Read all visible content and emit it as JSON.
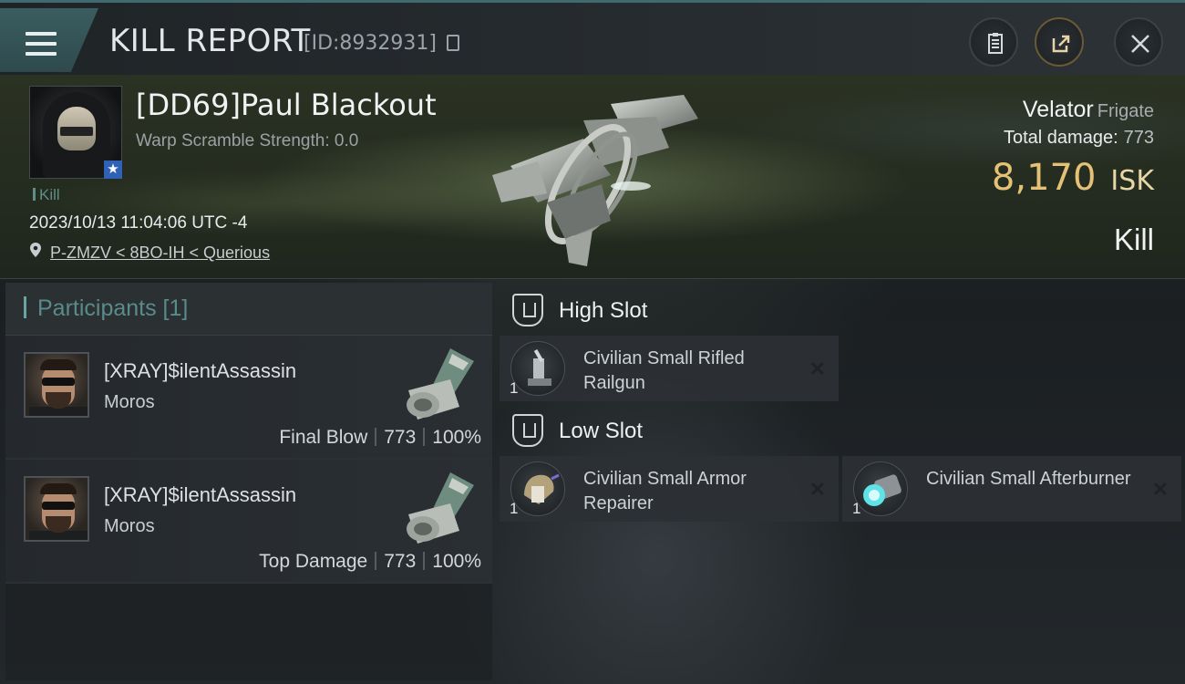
{
  "header": {
    "title": "KILL REPORT",
    "report_id": "[ID:8932931]"
  },
  "victim": {
    "name": "[DD69]Paul Blackout",
    "warp_scramble": "Warp Scramble Strength: 0.0",
    "tag": "Kill",
    "timestamp": "2023/10/13 11:04:06 UTC -4",
    "location": "P-ZMZV < 8BO-IH < Querious",
    "ship_name": "Velator",
    "ship_class": "Frigate",
    "total_damage_label": "Total damage:",
    "total_damage": "773",
    "isk_value": "8,170",
    "isk_unit": "ISK",
    "result": "Kill"
  },
  "participants": {
    "header": "Participants [1]",
    "rows": [
      {
        "name": "[XRAY]$ilentAssassin",
        "ship": "Moros",
        "role": "Final Blow",
        "damage": "773",
        "percent": "100%"
      },
      {
        "name": "[XRAY]$ilentAssassin",
        "ship": "Moros",
        "role": "Top Damage",
        "damage": "773",
        "percent": "100%"
      }
    ]
  },
  "fitting": {
    "high_slot": {
      "title": "High Slot",
      "modules": [
        {
          "name": "Civilian Small Rifled Railgun",
          "qty": "1"
        }
      ]
    },
    "low_slot": {
      "title": "Low Slot",
      "modules": [
        {
          "name": "Civilian Small Armor Repairer",
          "qty": "1"
        },
        {
          "name": "Civilian Small Afterburner",
          "qty": "1"
        }
      ]
    }
  },
  "icons": {
    "menu": "hamburger-icon",
    "copy": "copy-icon",
    "clipboard": "clipboard-icon",
    "share": "share-icon",
    "close": "close-icon",
    "location": "location-pin-icon",
    "slot": "slot-shield-icon",
    "remove": "x-icon"
  },
  "colors": {
    "accent_teal": "#5a8b8b",
    "isk_gold": "#e4c177",
    "star_badge": "#2f62b5"
  }
}
